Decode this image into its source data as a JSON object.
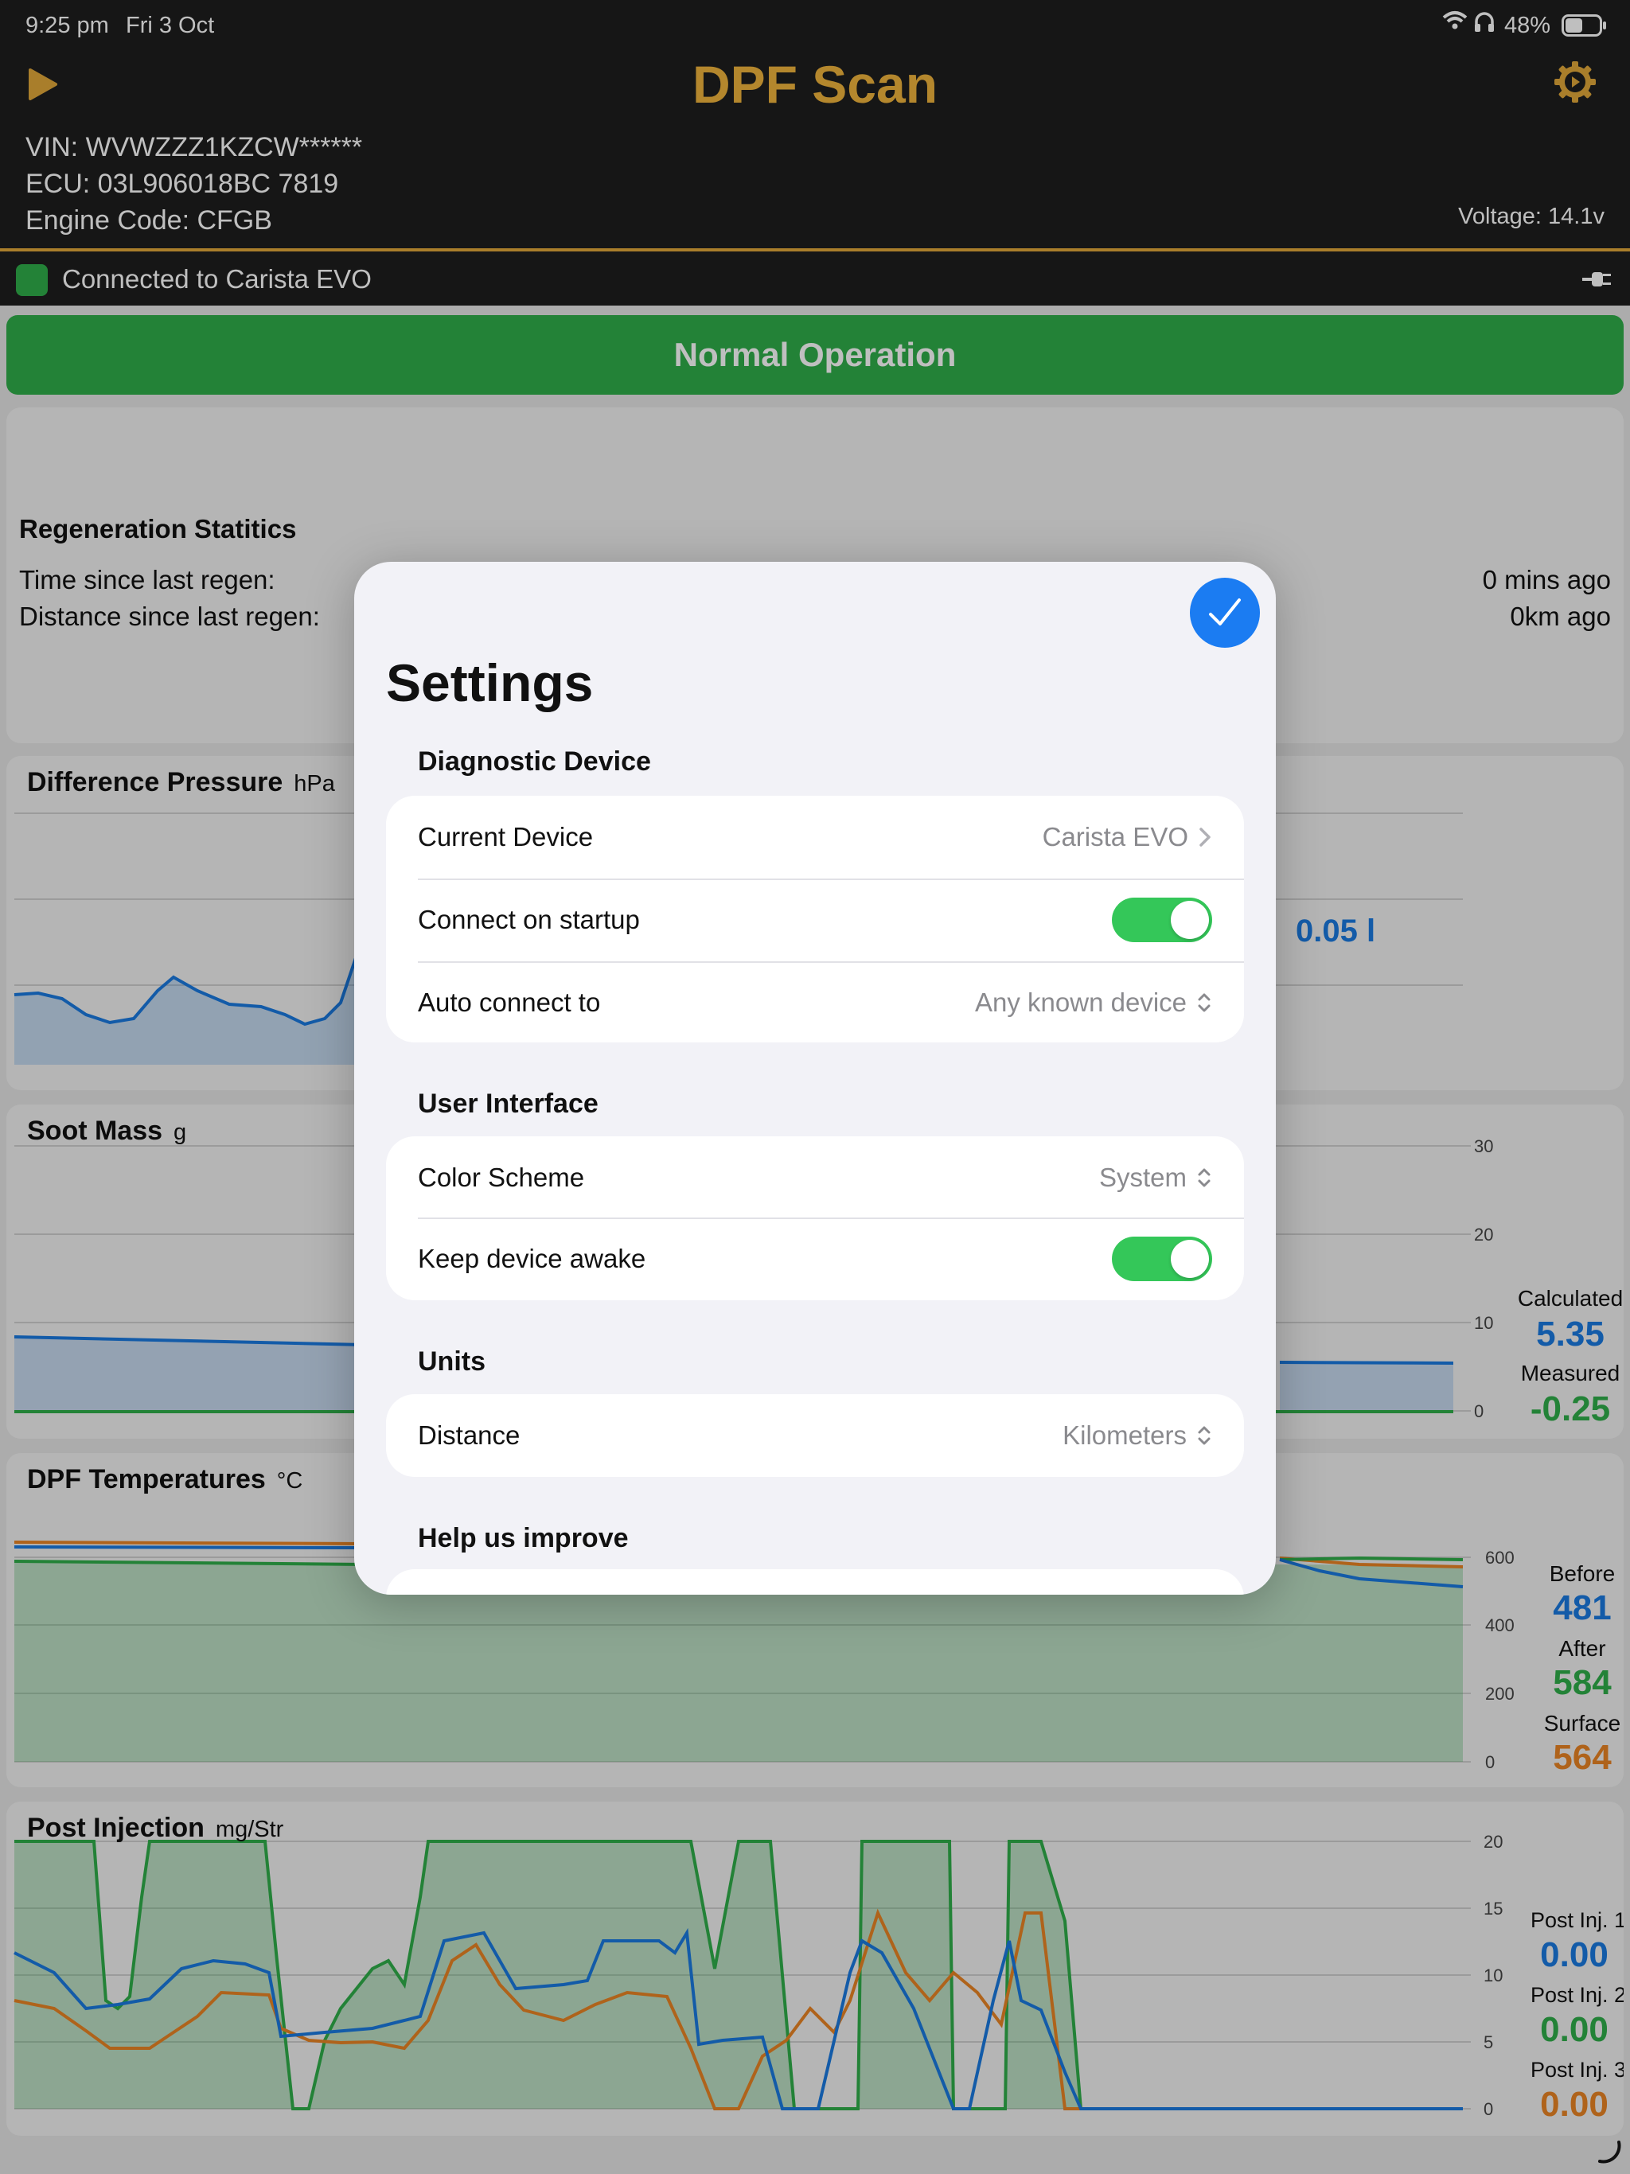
{
  "status_bar": {
    "time": "9:25 pm",
    "date": "Fri 3 Oct",
    "battery": "48%"
  },
  "header": {
    "title": "DPF Scan",
    "vin": "VIN: WVWZZZ1KZCW******",
    "ecu": "ECU: 03L906018BC 7819",
    "engine_code": "Engine Code: CFGB",
    "voltage": "Voltage: 14.1v"
  },
  "connection": {
    "text": "Connected to Carista EVO",
    "color": "#2fae4a"
  },
  "operation_status": {
    "label": "Normal Operation",
    "color": "#2fae4a"
  },
  "regen": {
    "title": "Regeneration Statitics",
    "time_label": "Time since last regen:",
    "time_value": "0 mins ago",
    "distance_label": "Distance since last regen:",
    "distance_value": "0km ago"
  },
  "diff_pressure": {
    "title": "Difference Pressure",
    "unit": "hPa",
    "side_value": "0.05 l"
  },
  "soot": {
    "title": "Soot Mass",
    "unit": "g",
    "ticks": [
      "30",
      "20",
      "10",
      "0"
    ],
    "calc_label": "Calculated",
    "calc_value": "5.35",
    "meas_label": "Measured",
    "meas_value": "-0.25"
  },
  "temps": {
    "title": "DPF Temperatures",
    "unit": "°C",
    "ticks": [
      "600",
      "400",
      "200",
      "0"
    ],
    "before_label": "Before",
    "before_value": "481",
    "after_label": "After",
    "after_value": "584",
    "surface_label": "Surface",
    "surface_value": "564"
  },
  "post_inj": {
    "title": "Post Injection",
    "unit": "mg/Str",
    "ticks": [
      "20",
      "15",
      "10",
      "5",
      "0"
    ],
    "p1_label": "Post Inj. 1",
    "p1_value": "0.00",
    "p2_label": "Post Inj. 2",
    "p2_value": "0.00",
    "p3_label": "Post Inj. 3",
    "p3_value": "0.00"
  },
  "settings": {
    "title": "Settings",
    "diag_header": "Diagnostic Device",
    "current_device_label": "Current Device",
    "current_device_value": "Carista EVO",
    "connect_startup_label": "Connect on startup",
    "connect_startup_on": true,
    "auto_connect_label": "Auto connect to",
    "auto_connect_value": "Any known device",
    "ui_header": "User Interface",
    "color_scheme_label": "Color Scheme",
    "color_scheme_value": "System",
    "keep_awake_label": "Keep device awake",
    "keep_awake_on": true,
    "units_header": "Units",
    "distance_label": "Distance",
    "distance_value": "Kilometers",
    "help_header": "Help us improve"
  },
  "colors": {
    "accent_yellow": "#f0b43c",
    "blue": "#1a7ae0",
    "green": "#2fae4a",
    "orange": "#ea8424",
    "toggle_on": "#34c759"
  }
}
